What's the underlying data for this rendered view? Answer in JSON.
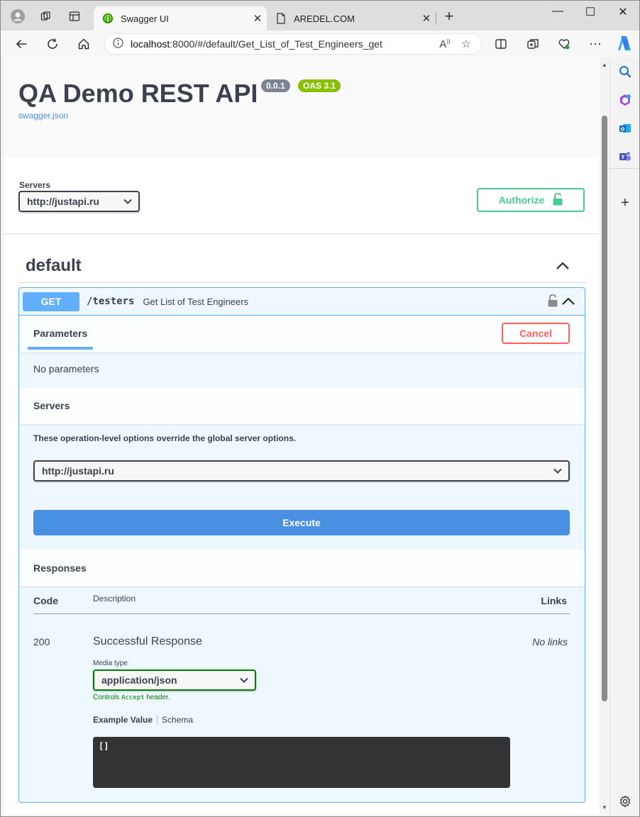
{
  "browser": {
    "tabs": [
      {
        "title": "Swagger UI",
        "active": true
      },
      {
        "title": "AREDEL.COM",
        "active": false
      }
    ],
    "address": {
      "host": "localhost",
      "path": ":8000/#/default/Get_List_of_Test_Engineers_get"
    }
  },
  "info": {
    "title": "QA Demo REST API",
    "version": "0.0.1",
    "oas": "OAS 3.1",
    "spec_link": "swagger.json"
  },
  "servers": {
    "label": "Servers",
    "selected": "http://justapi.ru",
    "authorize_label": "Authorize"
  },
  "tag": {
    "name": "default"
  },
  "operation": {
    "method": "GET",
    "path": "/testers",
    "summary": "Get List of Test Engineers",
    "params_tab": "Parameters",
    "cancel_label": "Cancel",
    "no_params": "No parameters",
    "servers_heading": "Servers",
    "override_note": "These operation-level options override the global server options.",
    "server_selected": "http://justapi.ru",
    "execute_label": "Execute",
    "responses_heading": "Responses",
    "columns": {
      "code": "Code",
      "description": "Description",
      "links": "Links"
    },
    "responses": [
      {
        "code": "200",
        "description": "Successful Response",
        "links": "No links",
        "media_type_label": "Media type",
        "media_type": "application/json",
        "controls_prefix": "Controls",
        "controls_code": "Accept",
        "controls_suffix": "header.",
        "example_tab": "Example Value",
        "schema_tab": "Schema",
        "example_value": "[]"
      }
    ]
  },
  "colors": {
    "get": "#61affe",
    "authorize": "#49cc90",
    "cancel": "#ff6060",
    "execute": "#4990e2",
    "oas_badge": "#89bf04",
    "version_badge": "#7d8492"
  }
}
